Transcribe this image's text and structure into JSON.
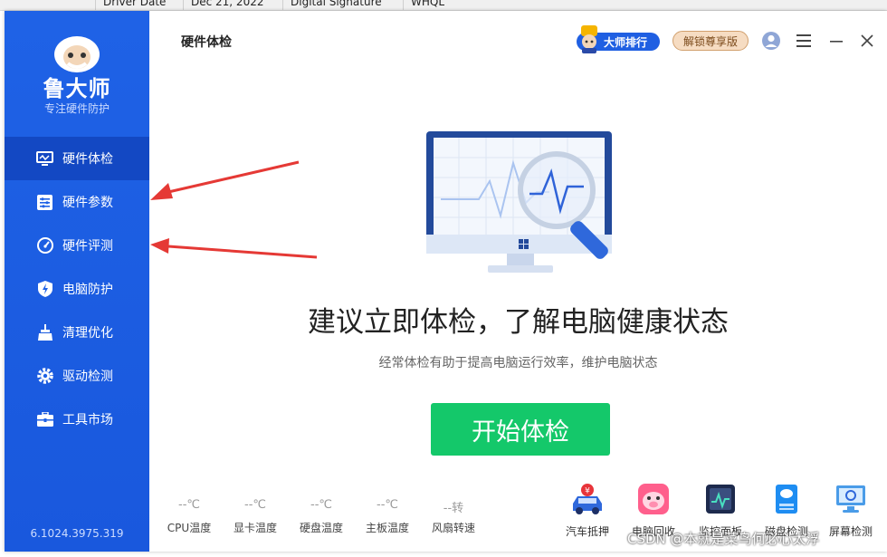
{
  "background_window": {
    "columns": [
      "Driver Date",
      "Dec 21, 2022",
      "Digital Signature",
      "WHQL"
    ]
  },
  "sidebar": {
    "logo_text": "鲁大师",
    "logo_sub": "专注硬件防护",
    "items": [
      {
        "label": "硬件体检",
        "icon": "monitor-pulse-icon",
        "active": true
      },
      {
        "label": "硬件参数",
        "icon": "sliders-icon",
        "active": false
      },
      {
        "label": "硬件评测",
        "icon": "speedometer-icon",
        "active": false
      },
      {
        "label": "电脑防护",
        "icon": "shield-lightning-icon",
        "active": false
      },
      {
        "label": "清理优化",
        "icon": "broom-icon",
        "active": false
      },
      {
        "label": "驱动检测",
        "icon": "gear-icon",
        "active": false
      },
      {
        "label": "工具市场",
        "icon": "toolbox-icon",
        "active": false
      }
    ],
    "version": "6.1024.3975.319"
  },
  "header": {
    "title": "硬件体检",
    "rank_label": "大师排行",
    "unlock_label": "解锁尊享版"
  },
  "main": {
    "headline": "建议立即体检，了解电脑健康状态",
    "subline": "经常体检有助于提高电脑运行效率，维护电脑状态",
    "start_label": "开始体检"
  },
  "sensors": [
    {
      "value": "--℃",
      "label": "CPU温度"
    },
    {
      "value": "--℃",
      "label": "显卡温度"
    },
    {
      "value": "--℃",
      "label": "硬盘温度"
    },
    {
      "value": "--℃",
      "label": "主板温度"
    },
    {
      "value": "--转",
      "label": "风扇转速"
    }
  ],
  "tools": [
    {
      "label": "汽车抵押",
      "icon": "car-pledge-icon"
    },
    {
      "label": "电脑回收",
      "icon": "pig-recycle-icon"
    },
    {
      "label": "监控面板",
      "icon": "monitor-panel-icon"
    },
    {
      "label": "磁盘检测",
      "icon": "disk-check-icon"
    },
    {
      "label": "屏幕检测",
      "icon": "screen-check-icon"
    }
  ],
  "watermark": "CSDN @本就是菜鸟何必心太浮",
  "colors": {
    "sidebar": "#1f62e6",
    "sidebar_active": "#1348c3",
    "start_button": "#14c86a",
    "arrow": "#e53935"
  }
}
